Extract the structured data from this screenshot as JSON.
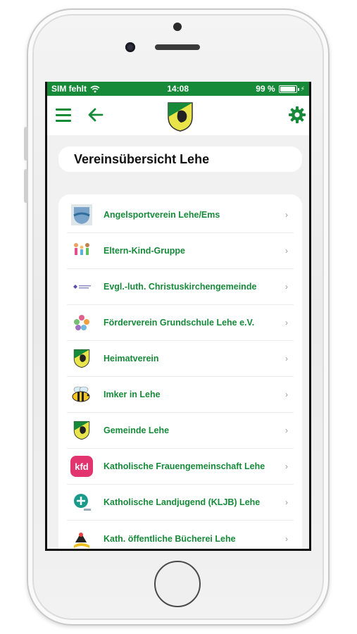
{
  "status": {
    "carrier": "SIM fehlt",
    "time": "14:08",
    "battery": "99 %",
    "battery_level": 0.99
  },
  "header": {
    "menu_icon": "hamburger-menu-icon",
    "back_icon": "arrow-left-icon",
    "logo_icon": "municipal-crest-icon",
    "settings_icon": "gear-icon"
  },
  "page": {
    "title": "Vereinsübersicht Lehe"
  },
  "clubs": [
    {
      "name": "Angelsportverein Lehe/Ems",
      "logo": "anglers-logo"
    },
    {
      "name": "Eltern-Kind-Gruppe",
      "logo": "family-logo"
    },
    {
      "name": "Evgl.-luth. Christuskirchengemeinde",
      "logo": "church-logo"
    },
    {
      "name": "Förderverein Grundschule Lehe e.V.",
      "logo": "school-association-logo"
    },
    {
      "name": "Heimatverein",
      "logo": "crest-logo"
    },
    {
      "name": "Imker in Lehe",
      "logo": "bee-logo"
    },
    {
      "name": "Gemeinde Lehe",
      "logo": "crest-logo"
    },
    {
      "name": "Katholische Frauengemeinschaft Lehe",
      "logo": "kfd-logo"
    },
    {
      "name": "Katholische Landjugend (KLJB) Lehe",
      "logo": "kljb-logo"
    },
    {
      "name": "Kath. öffentliche Bücherei Lehe",
      "logo": "library-logo"
    }
  ],
  "logos_text": {
    "kfd": "kfd"
  },
  "colors": {
    "accent": "#178a3a",
    "background": "#f1f1f1"
  }
}
